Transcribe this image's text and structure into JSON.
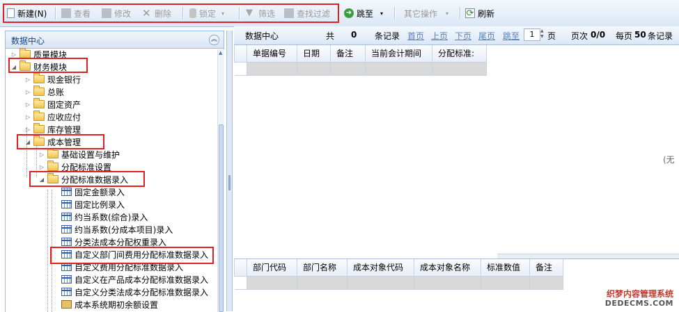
{
  "toolbar": {
    "new": "新建(N)",
    "view": "查看",
    "edit": "修改",
    "delete": "删除",
    "lock": "锁定",
    "filter": "筛选",
    "find_filter": "查找过滤",
    "jump": "跳至",
    "other_ops": "其它操作",
    "refresh": "刷新"
  },
  "left_panel": {
    "title": "数据中心",
    "tree": [
      "质量模块",
      "财务模块",
      "现金银行",
      "总账",
      "固定资产",
      "应收应付",
      "库存管理",
      "成本管理",
      "基础设置与维护",
      "分配标准设置",
      "分配标准数据录入",
      "固定金额录入",
      "固定比例录入",
      "约当系数(综合)录入",
      "约当系数(分成本项目)录入",
      "分类法成本分配权重录入",
      "自定义部门间费用分配标准数据录入",
      "自定义费用分配标准数据录入",
      "自定义在产品成本分配标准数据录入",
      "自定义分类法成本分配标准数据录入",
      "成本系统期初余额设置"
    ]
  },
  "pager": {
    "title": "数据中心",
    "total_label": "共",
    "total": "0",
    "records_label": "条记录",
    "first": "首页",
    "prev": "上页",
    "next": "下页",
    "last": "尾页",
    "jump": "跳至",
    "page_value": "1",
    "page_unit": "页",
    "page_count_label": "页次",
    "page_count": "0/0",
    "per_page_label": "每页",
    "per_page": "50",
    "per_page_suffix": "条记录"
  },
  "grid1": {
    "columns": [
      "单据编号",
      "日期",
      "备注",
      "当前会计期间",
      "分配标准:"
    ],
    "empty_text": "(无"
  },
  "grid2": {
    "columns": [
      "部门代码",
      "部门名称",
      "成本对象代码",
      "成本对象名称",
      "标准数值",
      "备注"
    ]
  },
  "watermark": {
    "line1": "织梦内容管理系统",
    "line2": "DEDECMS.COM"
  },
  "colors": {
    "highlight": "#e02020",
    "link": "#5a7fb6",
    "title": "#15428b"
  }
}
